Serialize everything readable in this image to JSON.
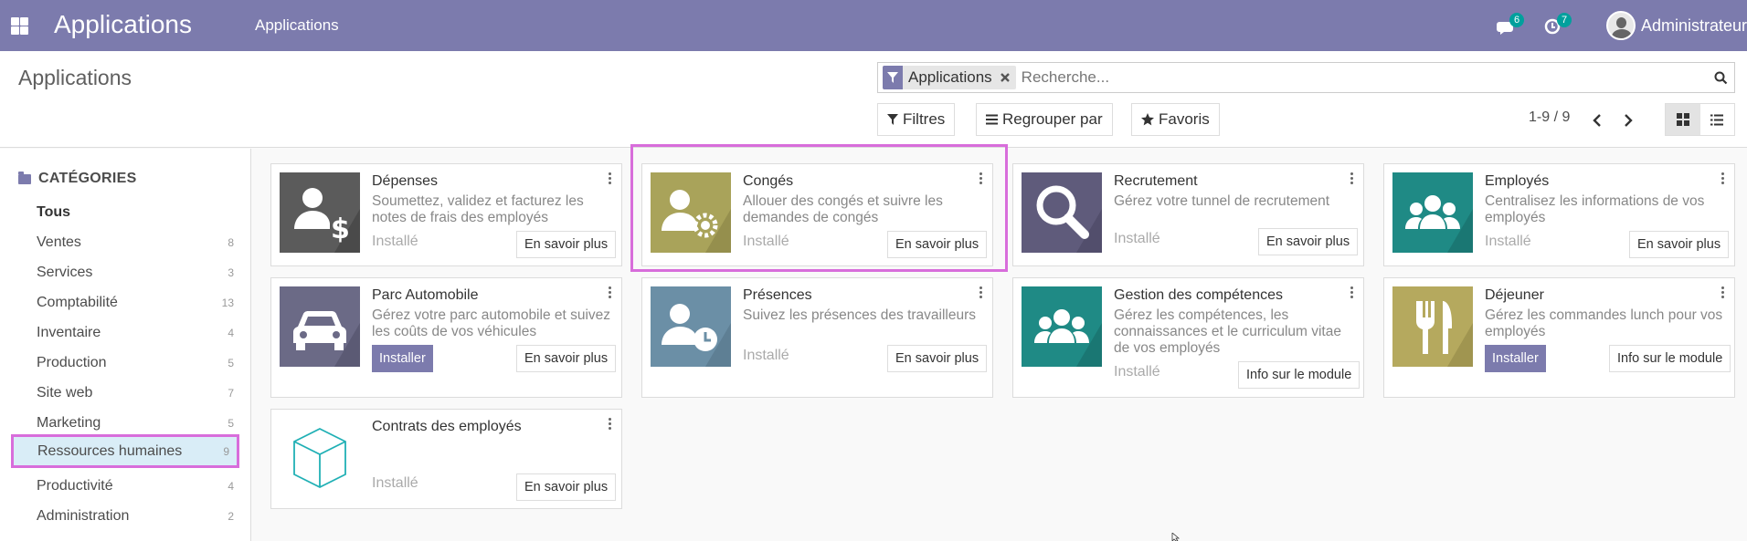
{
  "navbar": {
    "brand": "Applications",
    "menu_item": "Applications",
    "messages_count": "6",
    "activities_count": "7",
    "user_name": "Administrateur",
    "color": "#7c7bad"
  },
  "control_panel": {
    "title": "Applications",
    "search": {
      "facet_label": "Applications",
      "placeholder": "Recherche..."
    },
    "buttons": {
      "filters": "Filtres",
      "group_by": "Regrouper par",
      "favorites": "Favoris"
    },
    "pager": "1-9 / 9"
  },
  "sidebar": {
    "heading": "CATÉGORIES",
    "items": [
      {
        "label": "Tous",
        "count": ""
      },
      {
        "label": "Ventes",
        "count": "8"
      },
      {
        "label": "Services",
        "count": "3"
      },
      {
        "label": "Comptabilité",
        "count": "13"
      },
      {
        "label": "Inventaire",
        "count": "4"
      },
      {
        "label": "Production",
        "count": "5"
      },
      {
        "label": "Site web",
        "count": "7"
      },
      {
        "label": "Marketing",
        "count": "5"
      },
      {
        "label": "Ressources humaines",
        "count": "9"
      },
      {
        "label": "Productivité",
        "count": "4"
      },
      {
        "label": "Administration",
        "count": "2"
      }
    ],
    "selected": "Ressources humaines"
  },
  "apps": [
    {
      "title": "Dépenses",
      "description": "Soumettez, validez et facturez les notes de frais des employés",
      "status": "Installé",
      "button": "En savoir plus",
      "icon": "expenses-icon",
      "color": "#5b5b5b"
    },
    {
      "title": "Congés",
      "description": "Allouer des congés et suivre les demandes de congés",
      "status": "Installé",
      "button": "En savoir plus",
      "icon": "time-off-icon",
      "color": "#a9a35a"
    },
    {
      "title": "Recrutement",
      "description": "Gérez votre tunnel de recrutement",
      "status": "Installé",
      "button": "En savoir plus",
      "icon": "recruitment-icon",
      "color": "#5f5b7b"
    },
    {
      "title": "Employés",
      "description": "Centralisez les informations de vos employés",
      "status": "Installé",
      "button": "En savoir plus",
      "icon": "employees-icon",
      "color": "#1f8a85"
    },
    {
      "title": "Parc Automobile",
      "description": "Gérez votre parc automobile et suivez les coûts de vos véhicules",
      "status": "",
      "install": "Installer",
      "button": "En savoir plus",
      "icon": "fleet-icon",
      "color": "#6b6a86"
    },
    {
      "title": "Présences",
      "description": "Suivez les présences des travailleurs",
      "status": "Installé",
      "button": "En savoir plus",
      "icon": "attendance-icon",
      "color": "#6b8fa6"
    },
    {
      "title": "Gestion des compétences",
      "description": "Gérez les compétences, les connaissances et le curriculum vitae de vos employés",
      "status": "Installé",
      "button": "Info sur le module",
      "icon": "skills-icon",
      "color": "#1f8a85"
    },
    {
      "title": "Déjeuner",
      "description": "Gérez les commandes lunch pour vos employés",
      "status": "",
      "install": "Installer",
      "button": "Info sur le module",
      "icon": "lunch-icon",
      "color": "#b5a95e"
    },
    {
      "title": "Contrats des employés",
      "description": "",
      "status": "Installé",
      "button": "En savoir plus",
      "icon": "cube-icon",
      "color": "#21b0b5"
    }
  ]
}
